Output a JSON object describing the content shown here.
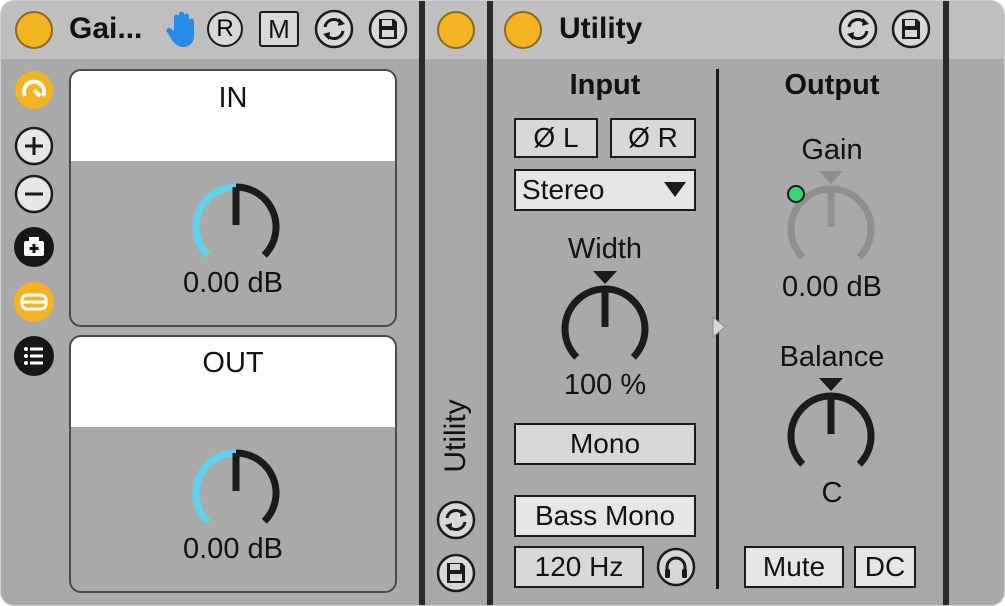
{
  "rack": {
    "title": "Gai...",
    "header_buttons": {
      "r_label": "R",
      "m_label": "M"
    },
    "macros": [
      {
        "label": "IN",
        "value": "0.00 dB"
      },
      {
        "label": "OUT",
        "value": "0.00 dB"
      }
    ],
    "side_icons": [
      "macro-view-icon",
      "add-macro-icon",
      "remove-macro-icon",
      "randomize-icon",
      "chain-list-icon",
      "preset-list-icon"
    ]
  },
  "chain": {
    "vertical_label": "Utility"
  },
  "utility": {
    "title": "Utility",
    "input": {
      "heading": "Input",
      "phase_left": "Ø L",
      "phase_right": "Ø R",
      "channel_mode": "Stereo",
      "width_label": "Width",
      "width_value": "100 %",
      "mono_label": "Mono",
      "bass_mono_label": "Bass Mono",
      "bass_freq": "120 Hz"
    },
    "output": {
      "heading": "Output",
      "gain_label": "Gain",
      "gain_value": "0.00 dB",
      "balance_label": "Balance",
      "balance_value": "C",
      "mute_label": "Mute",
      "dc_label": "DC"
    }
  },
  "colors": {
    "accent": "#f4b321",
    "knob_arc": "#5fd3ee",
    "panel": "#a9a9a9",
    "header": "#bfbfbf",
    "mod_led": "#3ad27a"
  }
}
